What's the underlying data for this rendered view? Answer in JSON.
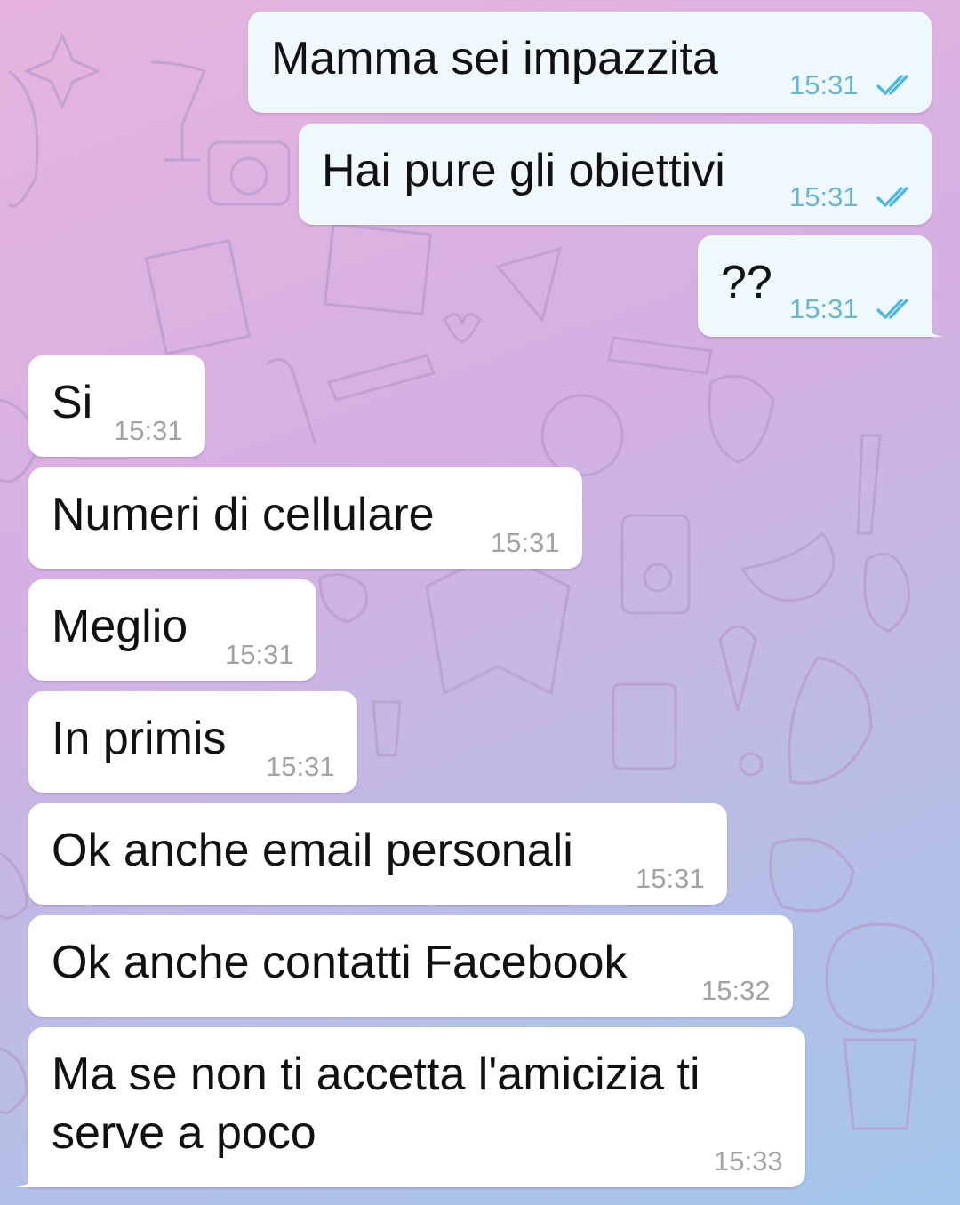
{
  "messages": [
    {
      "side": "out",
      "text": "Mamma sei impazzita",
      "time": "15:31",
      "status": "read-double-check-icon"
    },
    {
      "side": "out",
      "text": "Hai pure gli obiettivi",
      "time": "15:31",
      "status": "read-double-check-icon"
    },
    {
      "side": "out",
      "text": "??",
      "time": "15:31",
      "status": "read-double-check-icon"
    },
    {
      "side": "in",
      "text": "Si",
      "time": "15:31"
    },
    {
      "side": "in",
      "text": "Numeri di cellulare",
      "time": "15:31"
    },
    {
      "side": "in",
      "text": "Meglio",
      "time": "15:31"
    },
    {
      "side": "in",
      "text": "In primis",
      "time": "15:31"
    },
    {
      "side": "in",
      "text": "Ok anche email personali",
      "time": "15:31"
    },
    {
      "side": "in",
      "text": "Ok anche contatti Facebook",
      "time": "15:32"
    },
    {
      "side": "in",
      "text": "Ma se non ti accetta l'amicizia ti serve a poco",
      "time": "15:33"
    }
  ],
  "colors": {
    "outgoing_bubble": "#eef8fd",
    "incoming_bubble": "#ffffff",
    "outgoing_time": "#6ab6d1",
    "incoming_time": "#9ea3a8",
    "check": "#4fb6e0"
  }
}
